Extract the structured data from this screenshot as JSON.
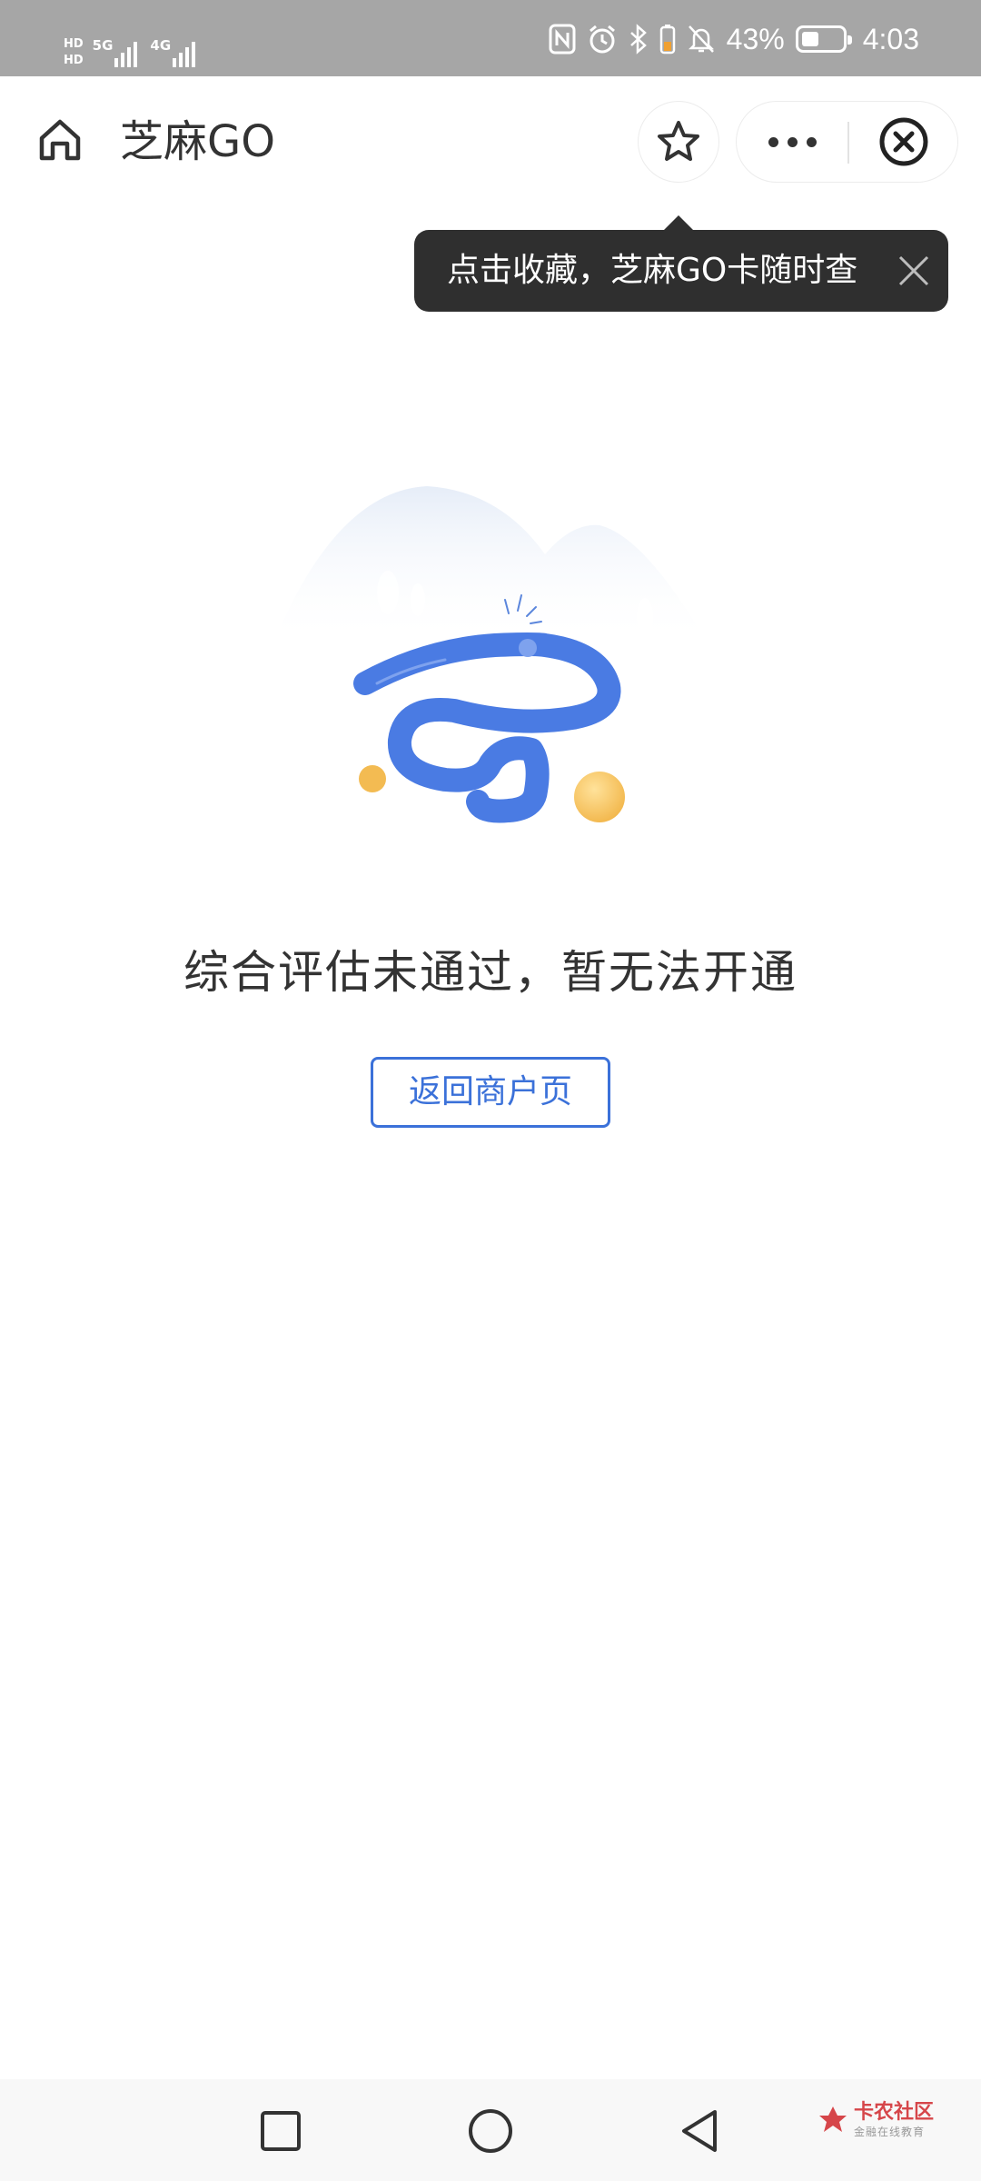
{
  "status_bar": {
    "hd_badge_1": "HD",
    "hd_badge_2": "HD",
    "network_1": "5G",
    "network_2": "4G",
    "battery_percent": "43%",
    "time": "4:03"
  },
  "header": {
    "title": "芝麻GO"
  },
  "tooltip": {
    "text": "点击收藏，芝麻GO卡随时查"
  },
  "result": {
    "message": "综合评估未通过，暂无法开通",
    "back_button_label": "返回商户页"
  },
  "watermark": {
    "title": "卡农社区",
    "subtitle": "金融在线教育"
  },
  "colors": {
    "accent_blue": "#3b71d9",
    "tooltip_bg": "#2f2f2f",
    "status_bar_bg": "#a6a6a6"
  },
  "icons": [
    "home-icon",
    "star-icon",
    "more-icon",
    "close-circle-icon",
    "close-icon",
    "nfc-icon",
    "alarm-icon",
    "bluetooth-icon",
    "mute-icon",
    "battery-icon",
    "square-icon",
    "circle-icon",
    "back-triangle-icon"
  ]
}
